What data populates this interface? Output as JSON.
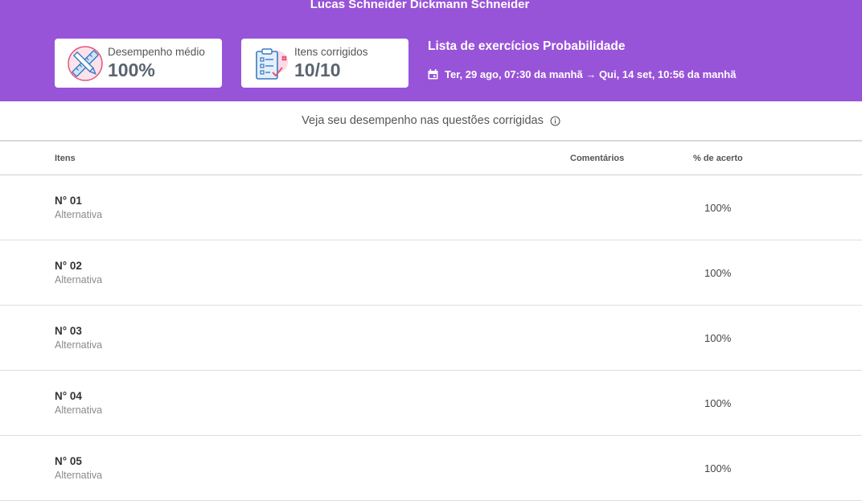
{
  "header": {
    "student_name": "Lucas Schneider Dickmann Schneider",
    "cards": [
      {
        "label": "Desempenho médio",
        "value": "100%",
        "icon": "pencil-ruler-icon"
      },
      {
        "label": "Itens corrigidos",
        "value": "10/10",
        "icon": "clipboard-checklist-icon"
      }
    ],
    "activity_title": "Lista de exercícios Probabilidade",
    "activity_dates": "Ter, 29 ago, 07:30 da manhã → Qui, 14 set, 10:56 da manhã",
    "color": "#9854d8"
  },
  "subtitle": "Veja seu desempenho nas questões corrigidas",
  "table": {
    "headers": {
      "items": "Itens",
      "comments": "Comentários",
      "accuracy": "% de acerto"
    },
    "rows": [
      {
        "number": "N° 01",
        "type": "Alternativa",
        "accuracy": "100%"
      },
      {
        "number": "N° 02",
        "type": "Alternativa",
        "accuracy": "100%"
      },
      {
        "number": "N° 03",
        "type": "Alternativa",
        "accuracy": "100%"
      },
      {
        "number": "N° 04",
        "type": "Alternativa",
        "accuracy": "100%"
      },
      {
        "number": "N° 05",
        "type": "Alternativa",
        "accuracy": "100%"
      }
    ]
  }
}
